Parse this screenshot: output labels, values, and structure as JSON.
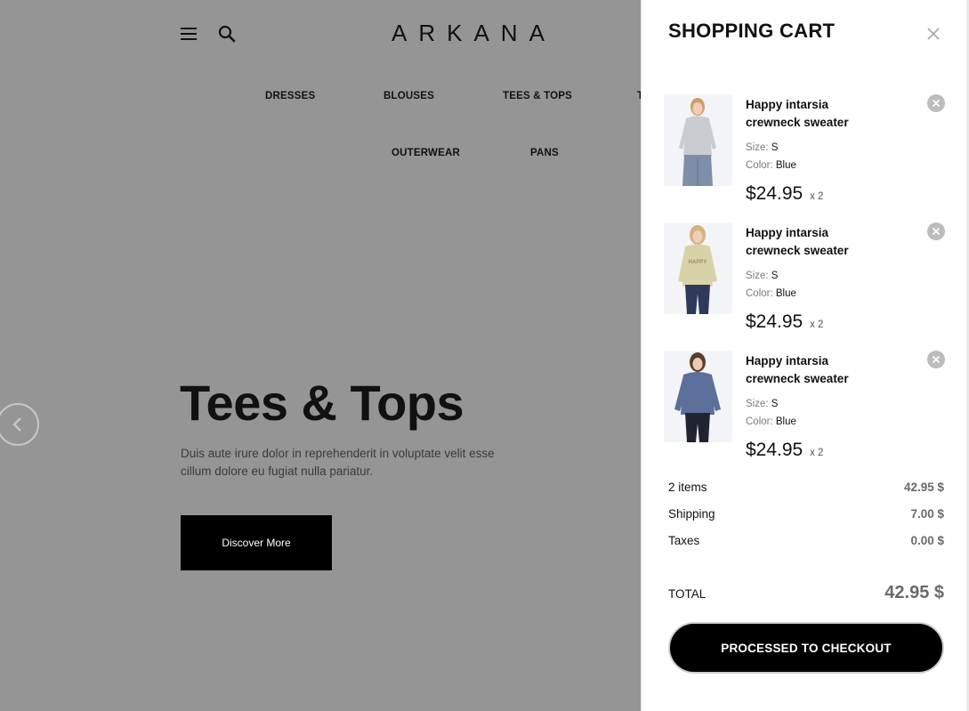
{
  "header": {
    "logo": "ARKANA"
  },
  "nav": {
    "items": [
      {
        "label": "DRESSES"
      },
      {
        "label": "BLOUSES"
      },
      {
        "label": "TEES & TOPS"
      },
      {
        "label": "T"
      },
      {
        "label": "OUTERWEAR"
      },
      {
        "label": "PANS"
      }
    ]
  },
  "hero": {
    "title": "Tees & Tops",
    "description": "Duis aute irure dolor in reprehenderit in voluptate velit esse cillum dolore eu fugiat nulla pariatur.",
    "button_label": "Discover More"
  },
  "cart": {
    "title": "SHOPPING CART",
    "items": [
      {
        "name": "Happy intarsia crewneck sweater",
        "size_label": "Size:",
        "size": "S",
        "color_label": "Color:",
        "color": "Blue",
        "price": "$24.95",
        "qty": "x 2",
        "image": "grey-top-model"
      },
      {
        "name": "Happy intarsia crewneck sweater",
        "size_label": "Size:",
        "size": "S",
        "color_label": "Color:",
        "color": "Blue",
        "price": "$24.95",
        "qty": "x 2",
        "image": "beige-sweater-model"
      },
      {
        "name": "Happy intarsia crewneck sweater",
        "size_label": "Size:",
        "size": "S",
        "color_label": "Color:",
        "color": "Blue",
        "price": "$24.95",
        "qty": "x 2",
        "image": "blue-sweater-model"
      }
    ],
    "summary": {
      "items_label": "2 items",
      "items_value": "42.95 $",
      "shipping_label": "Shipping",
      "shipping_value": "7.00 $",
      "taxes_label": "Taxes",
      "taxes_value": "0.00 $"
    },
    "total": {
      "label": "TOTAL",
      "value": "42.95 $"
    },
    "checkout_label": "PROCESSED TO CHECKOUT"
  },
  "colors": {
    "overlay_bg": "#959595",
    "accent": "#000000",
    "muted_value": "#6a6a6a"
  },
  "icons": [
    "menu-icon",
    "search-icon",
    "chevron-left-icon",
    "close-icon",
    "remove-icon"
  ]
}
